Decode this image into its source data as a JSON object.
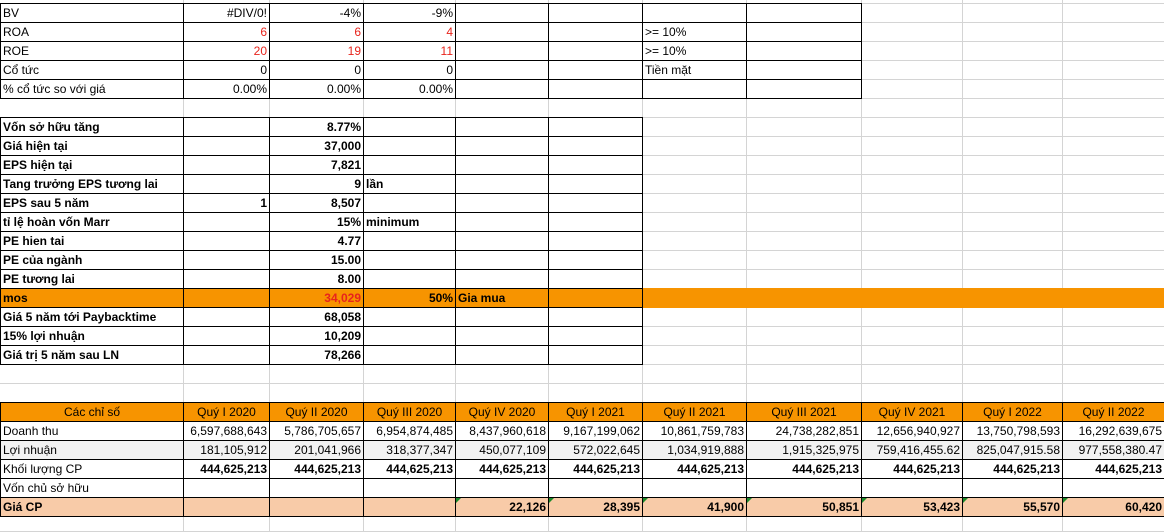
{
  "top_table": {
    "rows": [
      {
        "label": "BV",
        "values": [
          "#DIV/0!",
          "-4%",
          "-9%"
        ],
        "note": ""
      },
      {
        "label": "ROA",
        "values": [
          "6",
          "6",
          "4"
        ],
        "note": ">= 10%"
      },
      {
        "label": "ROE",
        "values": [
          "20",
          "19",
          "11"
        ],
        "note": ">= 10%"
      },
      {
        "label": "Cổ tức",
        "values": [
          "0",
          "0",
          "0"
        ],
        "note": "Tiền mặt"
      },
      {
        "label": "% cổ tức so với giá",
        "values": [
          "0.00%",
          "0.00%",
          "0.00%"
        ],
        "note": ""
      }
    ]
  },
  "valuation": {
    "rows": [
      {
        "label": "Vốn sở hữu tăng",
        "b": "",
        "c": "8.77%",
        "d": ""
      },
      {
        "label": "Giá hiện tại",
        "b": "",
        "c": "37,000",
        "d": ""
      },
      {
        "label": "EPS hiện tại",
        "b": "",
        "c": "7,821",
        "d": ""
      },
      {
        "label": "Tang trưởng EPS tương lai",
        "b": "",
        "c": "9",
        "d": "lần"
      },
      {
        "label": "EPS sau 5 năm",
        "b": "1",
        "c": "8,507",
        "d": ""
      },
      {
        "label": "tỉ lệ hoàn vốn Marr",
        "b": "",
        "c": "15%",
        "d": "minimum"
      },
      {
        "label": "PE hien tai",
        "b": "",
        "c": "4.77",
        "d": ""
      },
      {
        "label": "PE của ngành",
        "b": "",
        "c": "15.00",
        "d": ""
      },
      {
        "label": "PE tương lai",
        "b": "",
        "c": "8.00",
        "d": ""
      }
    ],
    "mos": {
      "label": "mos",
      "value": "34,029",
      "pct": "50%",
      "note": "Gia mua"
    },
    "rows2": [
      {
        "label": "Giá 5 năm tới Paybacktime",
        "c": "68,058"
      },
      {
        "label": "15% lợi nhuận",
        "c": "10,209"
      },
      {
        "label": "Giá trị 5 năm sau LN",
        "c": "78,266"
      }
    ]
  },
  "quarters": {
    "header_label": "Các chỉ số",
    "columns": [
      "Quý I 2020",
      "Quý II 2020",
      "Quý III 2020",
      "Quý IV 2020",
      "Quý I 2021",
      "Quý II 2021",
      "Quý III 2021",
      "Quý IV 2021",
      "Quý I 2022",
      "Quý II  2022"
    ],
    "rows": [
      {
        "label": "Doanh thu",
        "values": [
          "6,597,688,643",
          "5,786,705,657",
          "6,954,874,485",
          "8,437,960,618",
          "9,167,199,062",
          "10,861,759,783",
          "24,738,282,851",
          "12,656,940,927",
          "13,750,798,593",
          "16,292,639,675"
        ]
      },
      {
        "label": "Lợi nhuận",
        "values": [
          "181,105,912",
          "201,041,966",
          "318,377,347",
          "450,077,109",
          "572,022,645",
          "1,034,919,888",
          "1,915,325,975",
          "759,416,455.62",
          "825,047,915.58",
          "977,558,380.47"
        ]
      },
      {
        "label": "Khối lượng CP",
        "values": [
          "444,625,213",
          "444,625,213",
          "444,625,213",
          "444,625,213",
          "444,625,213",
          "444,625,213",
          "444,625,213",
          "444,625,213",
          "444,625,213",
          "444,625,213"
        ]
      },
      {
        "label": "Vốn chủ sở hữu",
        "values": [
          "",
          "",
          "",
          "",
          "",
          "",
          "",
          "",
          "",
          ""
        ]
      },
      {
        "label": "Giá CP",
        "values": [
          "",
          "",
          "",
          "22,126",
          "28,395",
          "41,900",
          "50,851",
          "53,423",
          "55,570",
          "60,420"
        ]
      }
    ]
  },
  "colors": {
    "orange": "#f79400",
    "peach": "#f8cba8",
    "red": "#e8241c",
    "green_marker": "#1a8a2a"
  }
}
